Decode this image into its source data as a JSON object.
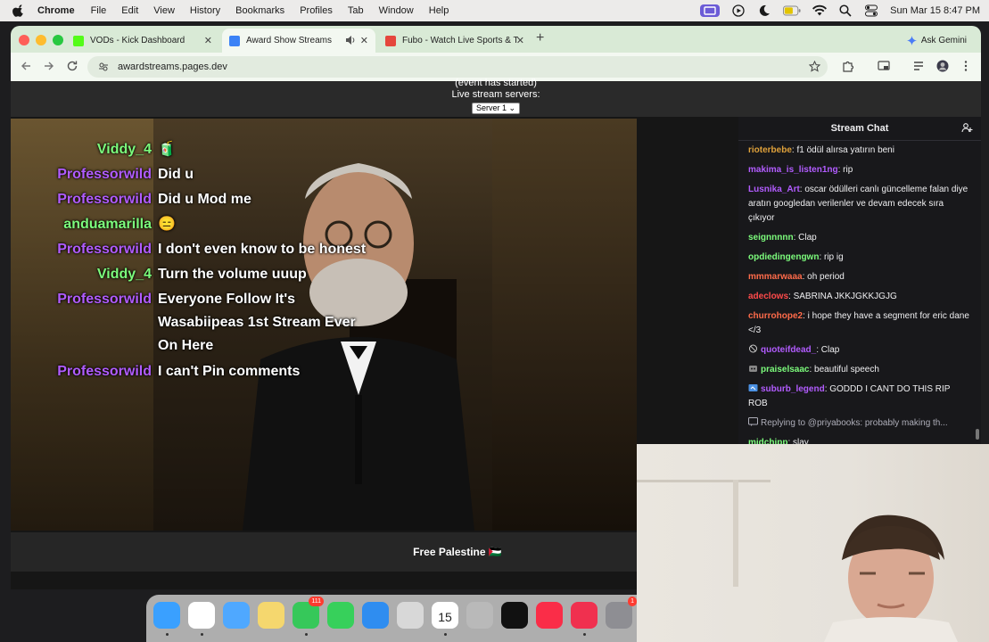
{
  "menubar": {
    "app_name": "Chrome",
    "items": [
      "File",
      "Edit",
      "View",
      "History",
      "Bookmarks",
      "Profiles",
      "Tab",
      "Window",
      "Help"
    ],
    "clock": "Sun Mar 15  8:47 PM"
  },
  "browser": {
    "tabs": [
      {
        "title": "VODs - Kick Dashboard",
        "favicon_color": "#53fc18"
      },
      {
        "title": "Award Show Streams",
        "favicon_color": "#3b82f6"
      },
      {
        "title": "Fubo - Watch Live Sports & T",
        "favicon_color": "#e5463c"
      }
    ],
    "ask_gemini": "Ask Gemini",
    "url": "awardstreams.pages.dev"
  },
  "page": {
    "event_note": "(event has started)",
    "servers_label": "Live stream servers:",
    "server_selected": "Server 1",
    "footer_text": "Free Palestine 🇵🇸"
  },
  "overlay_chat": [
    {
      "user": "Viddy_4",
      "user_color": "#7CFC7C",
      "msg": "🧃"
    },
    {
      "user": "Professorwild",
      "user_color": "#B15CFF",
      "msg": "Did u"
    },
    {
      "user": "Professorwild",
      "user_color": "#B15CFF",
      "msg": "Did u Mod me"
    },
    {
      "user": "anduamarilla",
      "user_color": "#7CFC7C",
      "msg": "😑"
    },
    {
      "user": "Professorwild",
      "user_color": "#B15CFF",
      "msg": "I don't even know to be honest"
    },
    {
      "user": "Viddy_4",
      "user_color": "#7CFC7C",
      "msg": "Turn the volume uuup"
    },
    {
      "user": "Professorwild",
      "user_color": "#B15CFF",
      "msg": "Everyone Follow It's"
    },
    {
      "user": "",
      "user_color": "#B15CFF",
      "msg": "Wasabiipeas 1st Stream Ever"
    },
    {
      "user": "",
      "user_color": "#B15CFF",
      "msg": "On Here"
    },
    {
      "user": "Professorwild",
      "user_color": "#B15CFF",
      "msg": "I can't Pin comments"
    }
  ],
  "stream_chat": {
    "title": "Stream Chat",
    "messages": [
      {
        "user": "rioterbebe",
        "color": "#e0a23b",
        "text": ": f1 ödül alırsa yatırın beni"
      },
      {
        "user": "makima_is_listen1ng",
        "color": "#b25cff",
        "text": ": rip"
      },
      {
        "user": "Lusnika_Art",
        "color": "#b25cff",
        "text": ": oscar ödülleri canlı güncelleme falan diye aratın googledan verilenler ve devam edecek sıra çıkıyor"
      },
      {
        "user": "seignnnnn",
        "color": "#7CFC7C",
        "text": ": Clap"
      },
      {
        "user": "opdiedingengwn",
        "color": "#7CFC7C",
        "text": ": rip ig"
      },
      {
        "user": "mmmarwaaa",
        "color": "#ff6b4a",
        "text": ": oh period"
      },
      {
        "user": "adeclows",
        "color": "#ff4a4a",
        "text": ": SABRINA JKKJGKKJGJG"
      },
      {
        "user": "churrohope2",
        "color": "#ff6b4a",
        "text": ": i hope they have a segment for eric dane </3"
      },
      {
        "user": "quoteifdead_",
        "color": "#b25cff",
        "text": ": Clap",
        "badge": "slash"
      },
      {
        "user": "praiselsaac",
        "color": "#7CFC7C",
        "text": ": beautiful speech",
        "badge": "bot"
      },
      {
        "user": "suburb_legend",
        "color": "#b25cff",
        "text": ": GODDD I CANT DO THIS RIP ROB",
        "badge": "tv"
      },
      {
        "user": "",
        "color": "#adadb8",
        "text": "Replying to @priyabooks: probably making th...",
        "badge": "reply"
      },
      {
        "user": "midchipp",
        "color": "#7CFC7C",
        "text": ": slay"
      }
    ]
  },
  "dock": {
    "calendar_day": "15",
    "messages_badge": "111",
    "settings_badge": "1",
    "icons": [
      "finder-icon",
      "chrome-icon",
      "mail-icon",
      "notes-icon",
      "messages-icon",
      "facetime-icon",
      "keynote-icon",
      "launchpad-icon",
      "calendar-icon",
      "contacts-icon",
      "appletv-icon",
      "music-icon",
      "news-icon",
      "settings-icon"
    ],
    "icon_colors": [
      "#3aa0ff",
      "#ffffff",
      "#4fa8ff",
      "#f5d76e",
      "#36c85a",
      "#37d05b",
      "#2f8df0",
      "#d8d8d8",
      "#ffffff",
      "#b9b9b9",
      "#111111",
      "#fa2d48",
      "#f0304f",
      "#8e8e93"
    ]
  }
}
